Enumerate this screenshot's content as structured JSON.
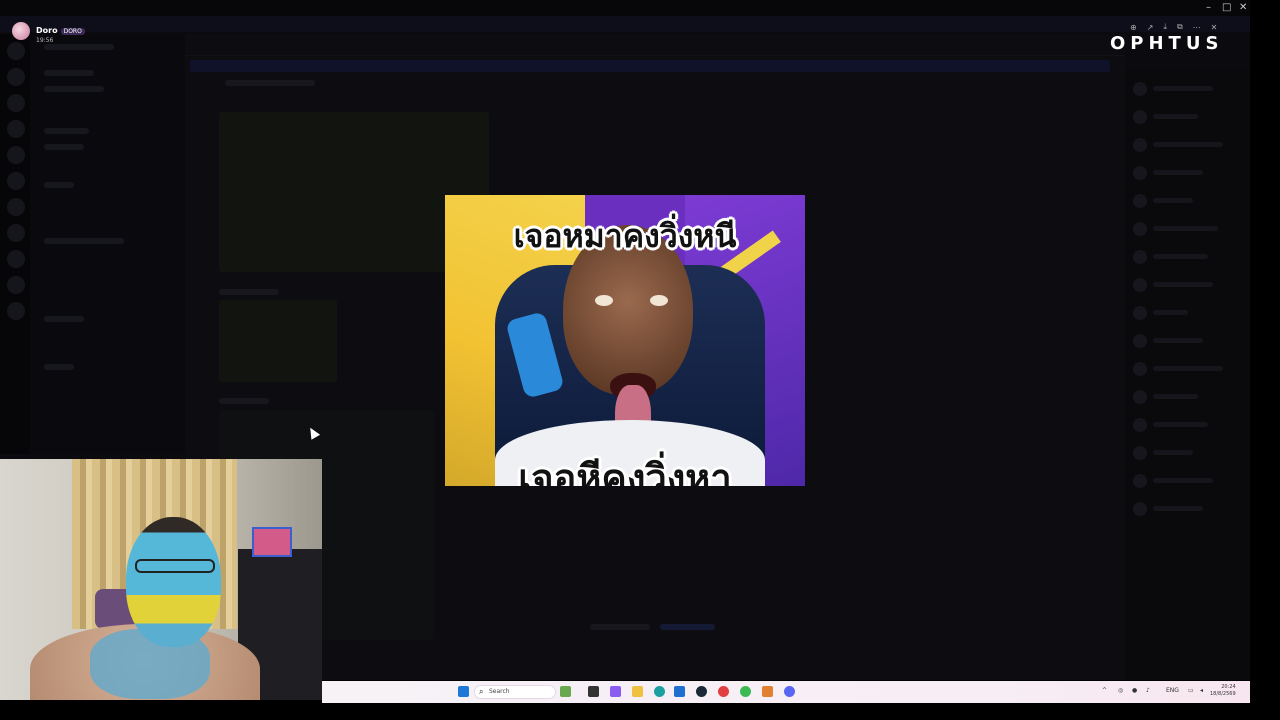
{
  "overlay": {
    "user": {
      "name": "Doro",
      "tag": "DORO",
      "time": "19:56"
    },
    "brand": "OPHTUS",
    "window_controls": {
      "minimize": "–",
      "maximize": "□",
      "close": "✕"
    }
  },
  "viewer_toolbar": {
    "icons": [
      "zoom-in-icon",
      "share-icon",
      "download-icon",
      "open-external-icon",
      "more-icon",
      "close-icon"
    ],
    "glyphs": [
      "⊕",
      "↗",
      "⤓",
      "⧉",
      "⋯",
      "✕"
    ]
  },
  "meme": {
    "caption_top": "เจอหมาคงวิ่งหนี",
    "caption_bottom": "เจอหีคงวิ่งหา"
  },
  "taskbar": {
    "search_placeholder": "Search",
    "language": "ENG",
    "time": "20:24",
    "date": "18/8/2569"
  },
  "colors": {
    "backdrop": "#0b0b0f",
    "taskbar": "#f6f2f6",
    "meme_purple": "#6a2fbf",
    "meme_yellow": "#f2c233"
  }
}
